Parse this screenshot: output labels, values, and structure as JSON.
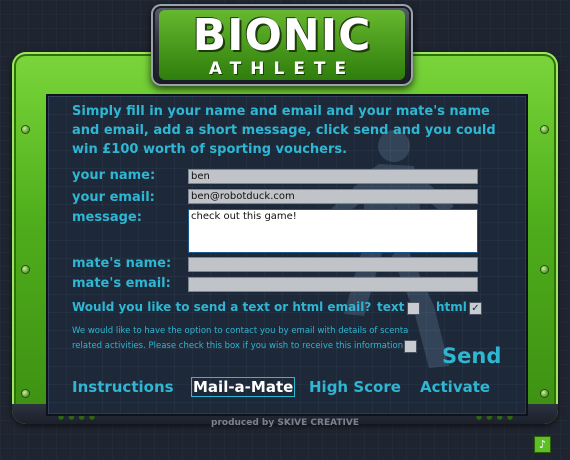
{
  "logo": {
    "title": "BIONIC",
    "subtitle": "ATHLETE"
  },
  "intro": "Simply fill in your name and email and your mate's name and email, add a short message, click send and you could win £100 worth of sporting vouchers.",
  "form": {
    "your_name": {
      "label": "your name:",
      "value": "ben"
    },
    "your_email": {
      "label": "your email:",
      "value": "ben@robotduck.com"
    },
    "message": {
      "label": "message:",
      "value": "check out this game!"
    },
    "mates_name": {
      "label": "mate's name:",
      "value": ""
    },
    "mates_email": {
      "label": "mate's email:",
      "value": ""
    }
  },
  "format": {
    "question": "Would you like to send a text or html email?",
    "text_label": "text",
    "text_checked": false,
    "html_label": "html",
    "html_checked": true
  },
  "optin": {
    "text": "We would like to have the option to contact you by email with details of scenta related activities. Please check this box if you wish to receive this information.",
    "checked": false
  },
  "send_label": "Send",
  "nav": {
    "instructions": "Instructions",
    "mail_a_mate": "Mail-a-Mate",
    "high_score": "High Score",
    "activate": "Activate"
  },
  "footer_credit": "produced by SKIVE CREATIVE",
  "icons": {
    "music": "music-note-icon"
  },
  "colors": {
    "accent_text": "#2fb6d2",
    "frame_green": "#4fae1c",
    "panel": "#1d2838"
  }
}
